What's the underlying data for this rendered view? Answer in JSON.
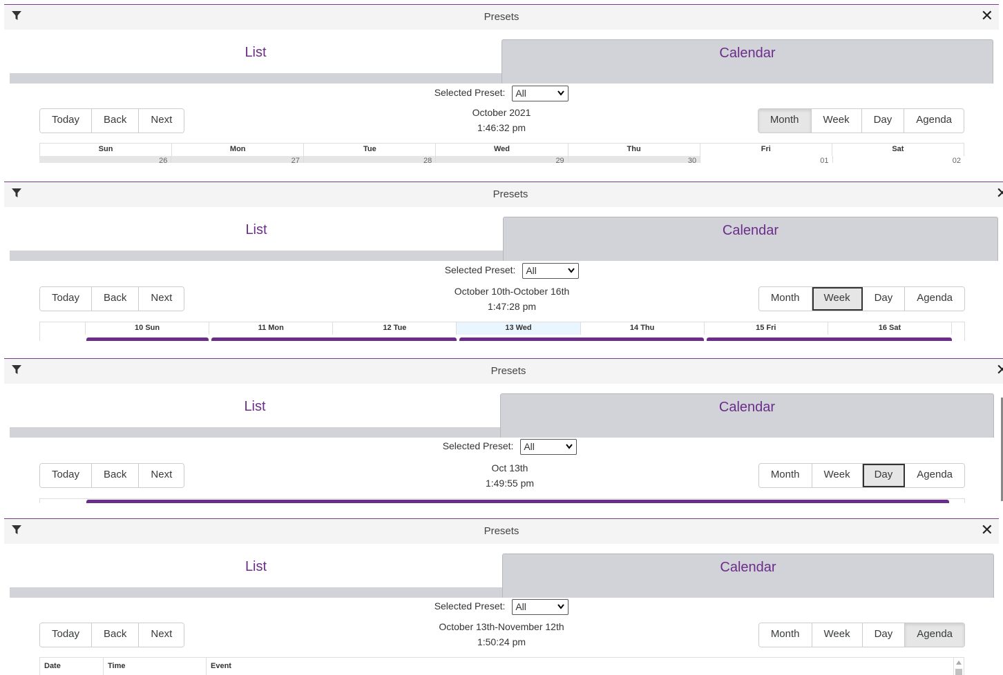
{
  "header": {
    "title": "Presets"
  },
  "tabs": {
    "list": "List",
    "calendar": "Calendar"
  },
  "preset": {
    "label": "Selected Preset:",
    "value": "All"
  },
  "nav": {
    "today": "Today",
    "back": "Back",
    "next": "Next"
  },
  "views": {
    "month": "Month",
    "week": "Week",
    "day": "Day",
    "agenda": "Agenda"
  },
  "panels": [
    {
      "view": "Month",
      "range_label": "October 2021",
      "time": "1:46:32 pm",
      "weekdays": [
        "Sun",
        "Mon",
        "Tue",
        "Wed",
        "Thu",
        "Fri",
        "Sat"
      ],
      "dates": [
        "26",
        "27",
        "28",
        "29",
        "30",
        "01",
        "02"
      ]
    },
    {
      "view": "Week",
      "range_label": "October 10th-October 16th",
      "time": "1:47:28 pm",
      "days": [
        "10 Sun",
        "11 Mon",
        "12 Tue",
        "13 Wed",
        "14 Thu",
        "15 Fri",
        "16 Sat"
      ]
    },
    {
      "view": "Day",
      "range_label": "Oct 13th",
      "time": "1:49:55 pm"
    },
    {
      "view": "Agenda",
      "range_label": "October 13th-November 12th",
      "time": "1:50:24 pm",
      "columns": [
        "Date",
        "Time",
        "Event"
      ]
    }
  ]
}
